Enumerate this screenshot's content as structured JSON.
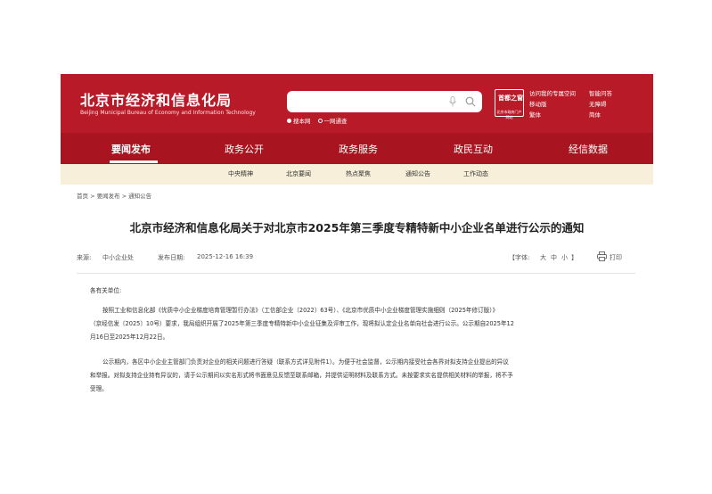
{
  "header": {
    "title": "北京市经济和信息化局",
    "subtitle": "Beijing Municipal Bureau of Economy and Information Technology",
    "search": {
      "placeholder": "",
      "options": [
        "搜本网",
        "一网通查"
      ]
    },
    "logo": {
      "top": "首都之窗",
      "bottom": "北京市政府门户网站"
    },
    "links": [
      "访问我的专属空间",
      "智能问答",
      "移动版",
      "无障碍",
      "繁体",
      "简体"
    ]
  },
  "nav": {
    "items": [
      "要闻发布",
      "政务公开",
      "政务服务",
      "政民互动",
      "经信数据"
    ]
  },
  "subnav": {
    "items": [
      "中央精神",
      "北京要闻",
      "热点聚焦",
      "通知公告",
      "工作动态"
    ]
  },
  "breadcrumb": "首页 > 要闻发布 > 通知公告",
  "article": {
    "title": "北京市经济和信息化局关于对北京市2025年第三季度专精特新中小企业名单进行公示的通知",
    "source_label": "来源:",
    "source": "中小企业处",
    "date_label": "发布日期:",
    "date": "2025-12-16 16:39",
    "font_label": "【字体:",
    "font_sizes": [
      "大",
      "中",
      "小"
    ],
    "font_close": "】",
    "print_label": "打印",
    "salutation": "各有关单位:",
    "p1": [
      "按照工业和信息化部《优质中小企业梯度培育管理暂行办法》（工信部企业〔2022〕63号）、《北京市优质中小企业梯度管理实施细则（2025年修订版）》",
      "（京经信发〔2025〕10号）要求，我局组织开展了2025年第三季度专精特新中小企业征集及评审工作，现将拟认定企业名单向社会进行公示。公示期自2025年12",
      "月16日至2025年12月22日。"
    ],
    "p2": [
      "公示期内，各区中小企业主管部门负责对企业的相关问题进行答疑（联系方式详见附件1）。为便于社会监督，公示期内接受社会各界对拟支持企业提出的异议",
      "和举报。对拟支持企业持有异议的，请于公示期间以实名形式将书面意见反馈至联系邮箱，并提供证明材料及联系方式。未按要求实名提供相关材料的举报，将不予",
      "受理。"
    ]
  }
}
